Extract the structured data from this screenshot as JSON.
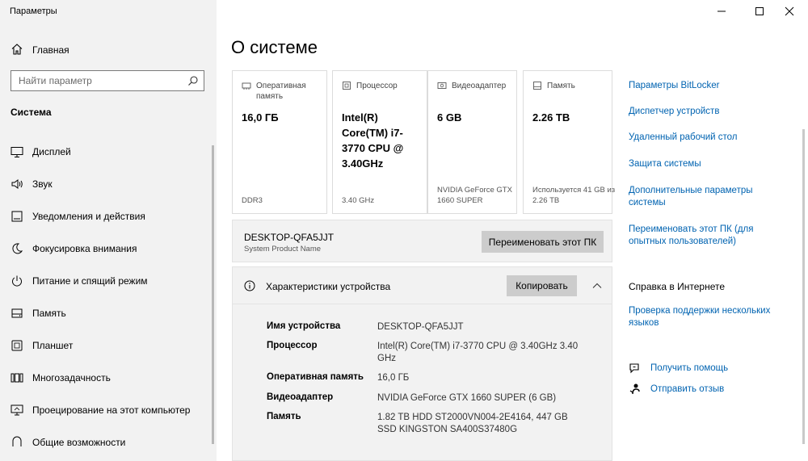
{
  "app": {
    "title": "Параметры"
  },
  "sidebar": {
    "home_label": "Главная",
    "search_placeholder": "Найти параметр",
    "section_title": "Система",
    "items": [
      {
        "label": "Дисплей",
        "icon": "monitor-icon"
      },
      {
        "label": "Звук",
        "icon": "speaker-icon"
      },
      {
        "label": "Уведомления и действия",
        "icon": "notification-icon"
      },
      {
        "label": "Фокусировка внимания",
        "icon": "moon-icon"
      },
      {
        "label": "Питание и спящий режим",
        "icon": "power-icon"
      },
      {
        "label": "Память",
        "icon": "storage-icon"
      },
      {
        "label": "Планшет",
        "icon": "tablet-icon"
      },
      {
        "label": "Многозадачность",
        "icon": "multitasking-icon"
      },
      {
        "label": "Проецирование на этот компьютер",
        "icon": "projecting-icon"
      },
      {
        "label": "Общие возможности",
        "icon": "shared-icon"
      }
    ]
  },
  "main": {
    "title": "О системе",
    "cards": [
      {
        "header": "Оперативная память",
        "value": "16,0 ГБ",
        "footer": "DDR3",
        "icon": "ram-icon"
      },
      {
        "header": "Процессор",
        "value": "Intel(R) Core(TM) i7-3770 CPU @ 3.40GHz",
        "footer": "3.40 GHz",
        "icon": "cpu-icon"
      },
      {
        "header": "Видеоадаптер",
        "value": "6 GB",
        "footer": "NVIDIA GeForce GTX 1660 SUPER",
        "icon": "gpu-icon"
      },
      {
        "header": "Память",
        "value": "2.26 TB",
        "footer": "Используется 41 GB из 2.26 TB",
        "icon": "drive-icon"
      }
    ],
    "pc": {
      "name": "DESKTOP-QFA5JJT",
      "subtitle": "System Product Name",
      "rename_label": "Переименовать этот ПК"
    },
    "specs": {
      "title": "Характеристики устройства",
      "copy_label": "Копировать",
      "rows": [
        {
          "key": "Имя устройства",
          "value": "DESKTOP-QFA5JJT"
        },
        {
          "key": "Процессор",
          "value": "Intel(R) Core(TM) i7-3770 CPU @ 3.40GHz   3.40 GHz"
        },
        {
          "key": "Оперативная память",
          "value": "16,0 ГБ"
        },
        {
          "key": "Видеоадаптер",
          "value": "NVIDIA GeForce GTX 1660 SUPER (6 GB)"
        },
        {
          "key": "Память",
          "value": "1.82 TB HDD ST2000VN004-2E4164, 447 GB SSD KINGSTON SA400S37480G"
        }
      ]
    }
  },
  "right": {
    "links": [
      "Параметры BitLocker",
      "Диспетчер устройств",
      "Удаленный рабочий стол",
      "Защита системы",
      "Дополнительные параметры системы",
      "Переименовать этот ПК (для опытных пользователей)"
    ],
    "help_title": "Справка в Интернете",
    "help_link": "Проверка поддержки нескольких языков",
    "get_help": "Получить помощь",
    "feedback": "Отправить отзыв"
  },
  "colors": {
    "accent": "#0063b1",
    "sidebar_bg": "#f2f2f2",
    "button_bg": "#cccccc"
  }
}
